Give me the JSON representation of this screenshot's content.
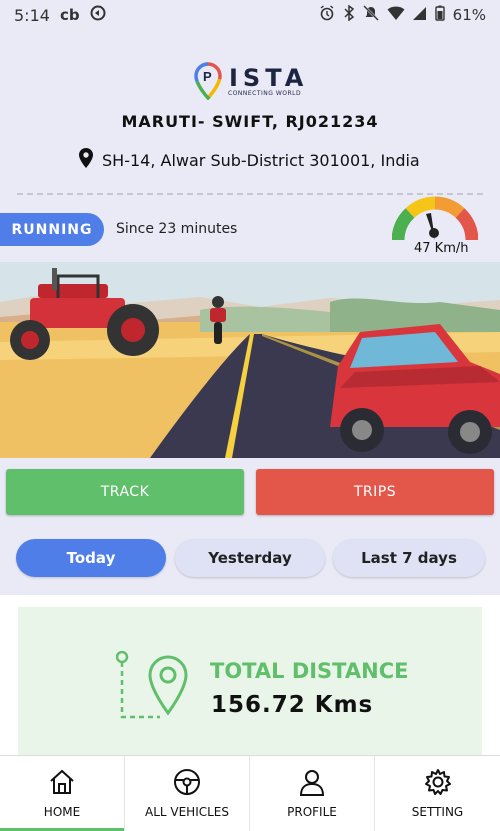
{
  "status_bar": {
    "time": "5:14",
    "carrier": "cb",
    "battery": "61%",
    "icons": [
      "alarm-icon",
      "bluetooth-icon",
      "mute-icon",
      "wifi-icon",
      "signal-icon",
      "battery-icon"
    ]
  },
  "brand": {
    "name": "ISTA",
    "tagline": "CONNECTING WORLD"
  },
  "vehicle": {
    "name": "MARUTI- SWIFT, RJ021234",
    "address": "SH-14, Alwar Sub-District 301001, India"
  },
  "status": {
    "state": "RUNNING",
    "since": "Since 23 minutes",
    "speed": "47 Km/h"
  },
  "actions": {
    "track": "TRACK",
    "trips": "TRIPS"
  },
  "filters": {
    "today": "Today",
    "yesterday": "Yesterday",
    "last7": "Last 7 days",
    "selected": "Today"
  },
  "stats": {
    "total_distance_label": "TOTAL DISTANCE",
    "total_distance_value": "156.72 Kms"
  },
  "nav": {
    "items": [
      {
        "label": "HOME",
        "icon": "home-icon"
      },
      {
        "label": "ALL VEHICLES",
        "icon": "steering-wheel-icon"
      },
      {
        "label": "PROFILE",
        "icon": "user-icon"
      },
      {
        "label": "SETTING",
        "icon": "gear-icon"
      }
    ],
    "active": "HOME"
  },
  "colors": {
    "primary_blue": "#4f7ee8",
    "green": "#5fbf6a",
    "red": "#e3574a",
    "background": "#e9eaf6"
  }
}
